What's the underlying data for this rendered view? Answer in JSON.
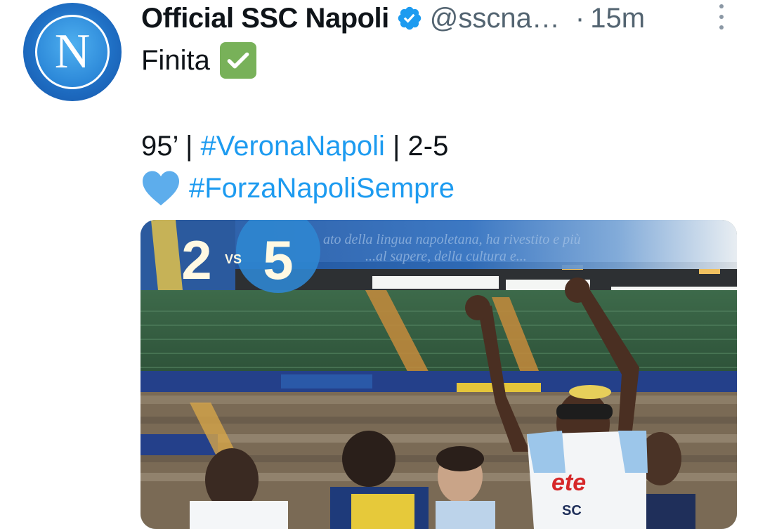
{
  "tweet": {
    "display_name": "Official SSC Napoli",
    "handle": "@sscna…",
    "separator": "·",
    "time": "15m",
    "avatar_letter": "N",
    "text_line1": "Finita",
    "score_prefix": "95’ | ",
    "hashtag1": "#VeronaNapoli",
    "score_suffix": " | 2-5",
    "hashtag2": "#ForzaNapoliSempre"
  },
  "media": {
    "score_home": "2",
    "score_vs": "VS",
    "score_away": "5",
    "banner_text_1": "ato della lingua napoletana, ha rivestito e più",
    "banner_text_2": "...al sapere, della cultura e..."
  },
  "icons": {
    "verified": "verified-badge-icon",
    "check": "check-mark-icon",
    "heart": "blue-heart-icon",
    "more": "more-options-icon"
  },
  "colors": {
    "link": "#1d9bf0",
    "secondary_text": "#536471",
    "verified": "#1d9bf0",
    "check_bg": "#78b159",
    "heart": "#5dadec"
  }
}
